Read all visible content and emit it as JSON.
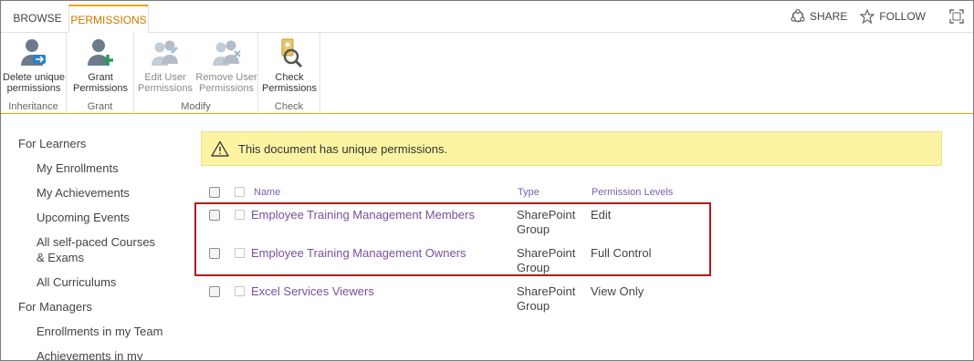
{
  "tabs": {
    "browse": "BROWSE",
    "permissions": "PERMISSIONS"
  },
  "top_actions": {
    "share": "SHARE",
    "follow": "FOLLOW"
  },
  "ribbon": {
    "groups": {
      "inheritance": "Inheritance",
      "grant": "Grant",
      "modify": "Modify",
      "check": "Check"
    },
    "buttons": {
      "delete_unique": "Delete unique\npermissions",
      "grant_permissions": "Grant\nPermissions",
      "edit_user": "Edit User\nPermissions",
      "remove_user": "Remove User\nPermissions",
      "check_permissions": "Check\nPermissions"
    }
  },
  "nav": [
    {
      "label": "For Learners",
      "sub": false
    },
    {
      "label": "My Enrollments",
      "sub": true
    },
    {
      "label": "My Achievements",
      "sub": true
    },
    {
      "label": "Upcoming Events",
      "sub": true
    },
    {
      "label": "All self-paced Courses & Exams",
      "sub": true
    },
    {
      "label": "All Curriculums",
      "sub": true
    },
    {
      "label": "For Managers",
      "sub": false
    },
    {
      "label": "Enrollments in my Team",
      "sub": true
    },
    {
      "label": "Achievements in my",
      "sub": true
    }
  ],
  "alert": {
    "text": "This document has unique permissions."
  },
  "table": {
    "headers": {
      "name": "Name",
      "type": "Type",
      "levels": "Permission Levels"
    },
    "rows": [
      {
        "name": "Employee Training Management Members",
        "type_line1": "SharePoint",
        "type_line2": "Group",
        "level": "Edit"
      },
      {
        "name": "Employee Training Management Owners",
        "type_line1": "SharePoint",
        "type_line2": "Group",
        "level": "Full Control"
      },
      {
        "name": "Excel Services Viewers",
        "type_line1": "SharePoint",
        "type_line2": "Group",
        "level": "View Only"
      }
    ]
  },
  "colors": {
    "accent": "#f0a30a",
    "link": "#7a4fa0",
    "alert_bg": "#fcf4a3",
    "highlight": "#b11a1a"
  }
}
